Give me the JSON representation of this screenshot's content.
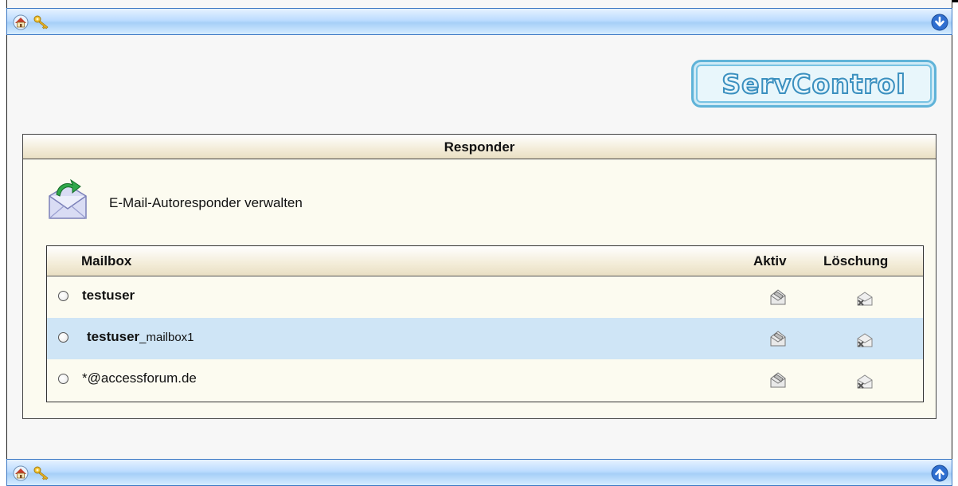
{
  "logo": {
    "text": "ServControl"
  },
  "panel": {
    "title": "Responder",
    "description": "E-Mail-Autoresponder verwalten"
  },
  "table": {
    "headers": {
      "mailbox": "Mailbox",
      "active": "Aktiv",
      "delete": "Löschung"
    },
    "rows": [
      {
        "name": "testuser",
        "suffix": ""
      },
      {
        "name": "testuser",
        "suffix": "_mailbox1",
        "selected_highlight": true
      },
      {
        "name": "*@accessforum.de",
        "suffix": ""
      }
    ]
  },
  "colors": {
    "bar_blue": "#a6cff8",
    "panel_bg": "#fcfbf0",
    "row_highlight": "#cfe5f6",
    "logo_blue": "#3a8fbf"
  },
  "icons": {
    "top_bar": [
      "home-icon",
      "keys-icon",
      "scroll-down-icon"
    ],
    "bottom_bar": [
      "home-icon",
      "keys-icon",
      "scroll-up-icon"
    ],
    "row_actions": [
      "active-envelope-icon",
      "delete-envelope-icon"
    ]
  }
}
